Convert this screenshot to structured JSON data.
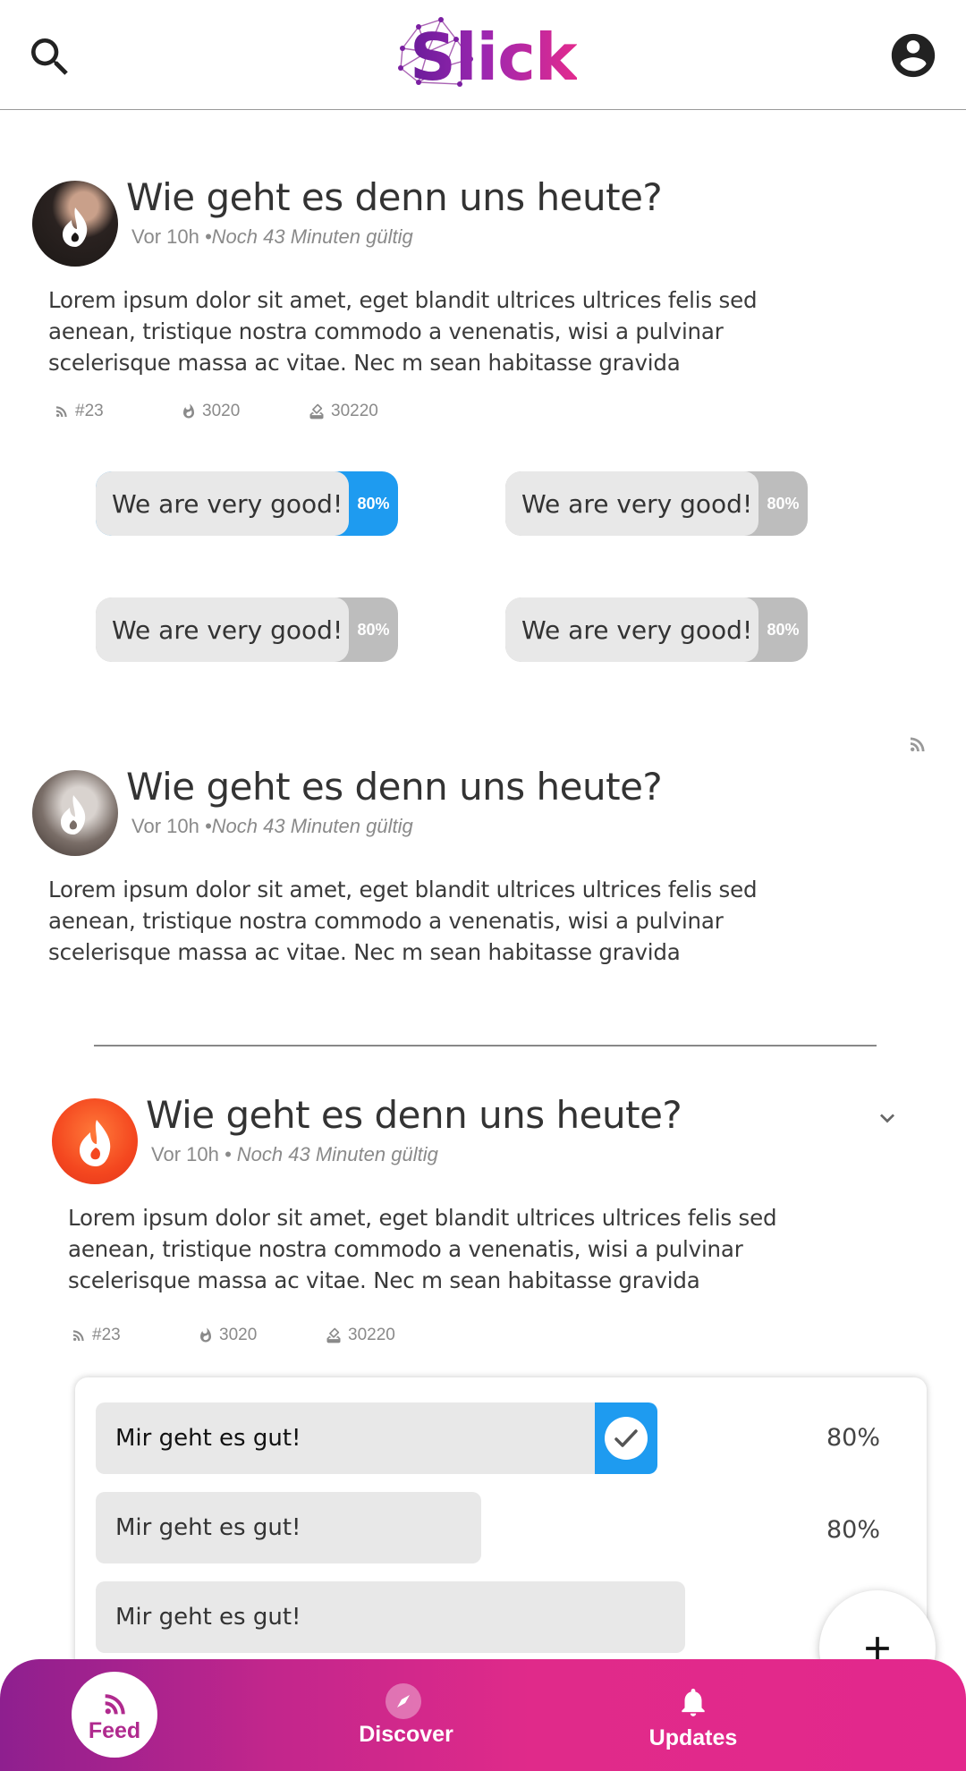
{
  "header": {
    "logo_text": "Slick"
  },
  "colors": {
    "accent_blue": "#1e9bf0",
    "brand_pink": "#e22a8e",
    "brand_purple": "#8e1f8f"
  },
  "posts": [
    {
      "title": "Wie geht es denn uns heute?",
      "time": "Vor 10h",
      "valid": "•Noch 43 Minuten gültig",
      "body": "Lorem ipsum dolor sit amet, eget blandit ultrices ultrices felis sed aenean, tristique nostra commodo a venenatis, wisi a pulvinar scelerisque massa ac vitae. Nec m sean habitasse gravida",
      "stats": {
        "feed": "#23",
        "fire": "3020",
        "votes": "30220"
      },
      "options": [
        {
          "label": "We are very good!",
          "pct": "80%",
          "selected": true
        },
        {
          "label": "We are very good!",
          "pct": "80%",
          "selected": false
        },
        {
          "label": "We are very good!",
          "pct": "80%",
          "selected": false
        },
        {
          "label": "We are very good!",
          "pct": "80%",
          "selected": false
        }
      ]
    },
    {
      "title": "Wie geht es denn uns heute?",
      "time": "Vor 10h",
      "valid": "•Noch 43 Minuten gültig",
      "body": "Lorem ipsum dolor sit amet, eget blandit ultrices ultrices felis sed aenean, tristique nostra commodo a venenatis, wisi a pulvinar scelerisque massa ac vitae. Nec m sean habitasse gravida"
    },
    {
      "title": "Wie geht es denn uns heute?",
      "time": "Vor 10h",
      "valid": "• Noch 43 Minuten gültig",
      "body": "Lorem ipsum dolor sit amet, eget blandit ultrices ultrices felis sed aenean, tristique nostra commodo a venenatis, wisi a pulvinar scelerisque massa ac vitae. Nec m sean habitasse gravida",
      "stats": {
        "feed": "#23",
        "fire": "3020",
        "votes": "30220"
      },
      "results": [
        {
          "label": "Mir geht es gut!",
          "pct": "80%",
          "checked": true,
          "fill": 0.8
        },
        {
          "label": "Mir geht es gut!",
          "pct": "80%",
          "checked": false,
          "fill": 0.55
        },
        {
          "label": "Mir geht es gut!",
          "pct": "",
          "checked": false,
          "fill": 0.84
        }
      ]
    }
  ],
  "nav": {
    "feed": "Feed",
    "discover": "Discover",
    "updates": "Updates",
    "active": "feed"
  }
}
